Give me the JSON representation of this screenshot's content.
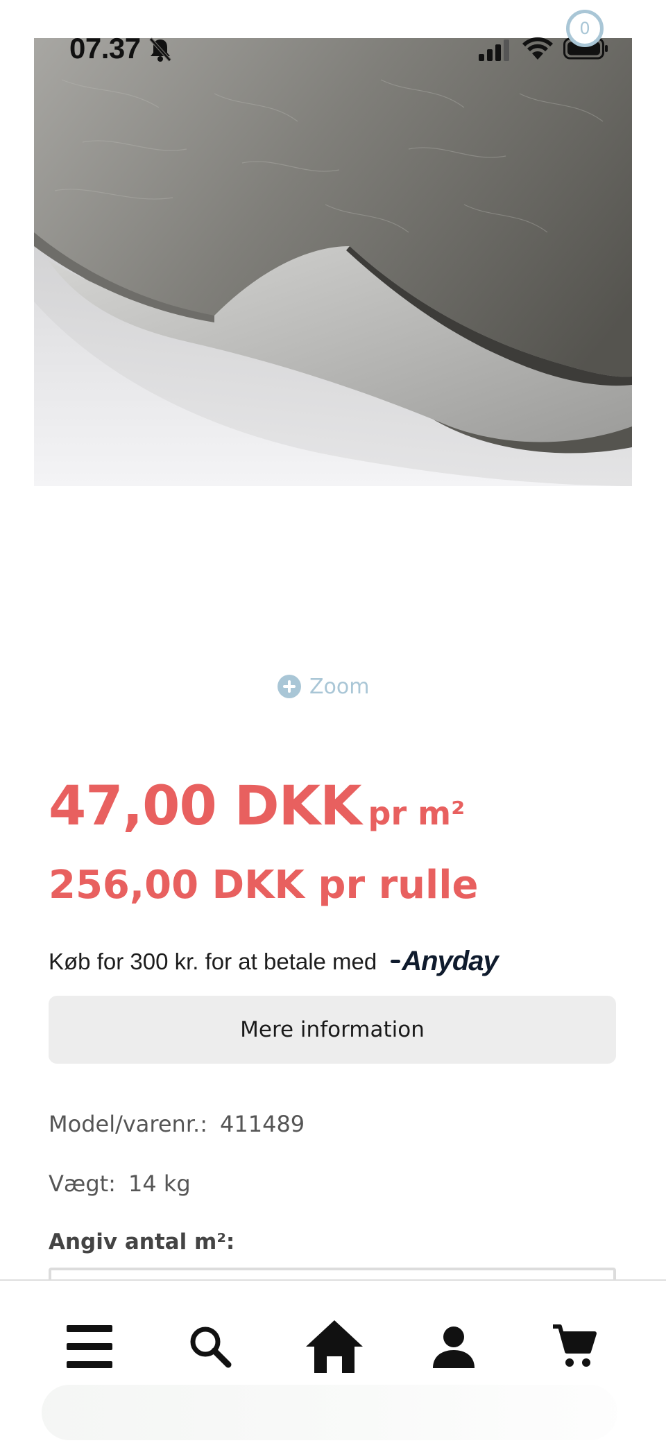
{
  "status_bar": {
    "time": "07.37",
    "icons": [
      "bell-slash-icon",
      "cellular-signal-icon",
      "wifi-icon",
      "battery-icon"
    ]
  },
  "product": {
    "image_alt": "product-photo-rolled-sound-damping-mat",
    "zoom_label": "Zoom",
    "price_per_m2": "47,00 DKK",
    "price_per_m2_unit": "pr m²",
    "price_per_roll": "256,00 DKK pr rulle",
    "anyday_text": "Køb for 300 kr. for at betale med",
    "anyday_brand": "Anyday",
    "more_info_label": "Mere information",
    "model_label": "Model/varenr.:",
    "model_value": "411489",
    "weight_label": "Vægt:",
    "weight_value": "14 kg",
    "quantity_label": "Angiv antal m²:",
    "quantity_value": ""
  },
  "bottom_nav": {
    "items": [
      {
        "name": "menu",
        "icon": "hamburger-menu-icon"
      },
      {
        "name": "search",
        "icon": "search-icon"
      },
      {
        "name": "home",
        "icon": "home-icon"
      },
      {
        "name": "account",
        "icon": "user-icon"
      },
      {
        "name": "cart",
        "icon": "cart-icon"
      }
    ],
    "cart_count": "0"
  },
  "colors": {
    "price": "#e8605f",
    "accent": "#a9c6d6",
    "button_bg": "#ededed",
    "brand_dark": "#0f1b2d"
  }
}
